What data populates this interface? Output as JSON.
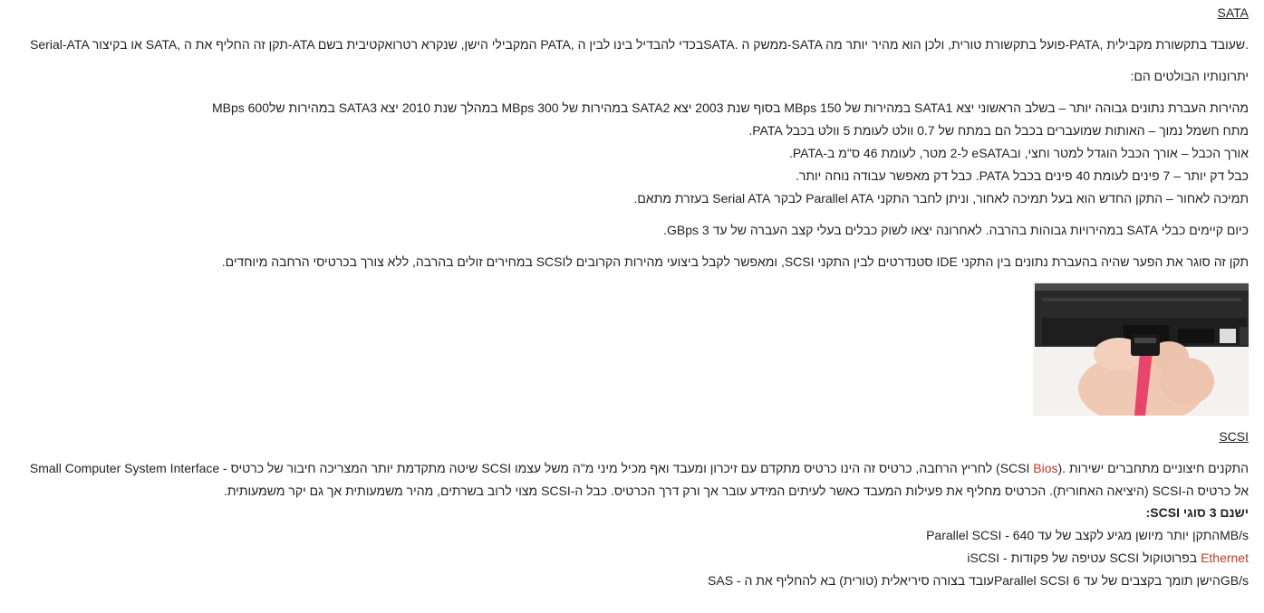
{
  "sata": {
    "heading": "SATA",
    "intro": "Serial-ATA או בקיצור SATA, תקן זה החליף את ה-ATA המקבילי הישן, שנקרא רטרואקטיבית בשם PATA, בכדי להבדיל בינו לבין הSATA. ממשק ה-SATA פועל בתקשורת טורית, ולכן הוא מהיר יותר מה-PATA, שעובד בתקשורת מקבילית.",
    "advantages_title": "יתרונותיו הבולטים הם:",
    "advantages": [
      "מהירות העברת נתונים גבוהה יותר – בשלב הראשוני יצא SATA1 במהירות של 150 MBps בסוף שנת 2003 יצא SATA2 במהירות של 300 MBps במהלך שנת 2010 יצא SATA3 במהירות של600 MBps",
      "מתח חשמל נמוך – האותות שמועברים בכבל הם במתח של 0.7 וולט לעומת 5 וולט בכבל PATA.",
      "אורך הכבל – אורך הכבל הוגדל למטר וחצי, ובeSATA ל-2 מטר, לעומת 46 ס\"מ ב-PATA.",
      "כבל דק יותר – 7 פינים לעומת 40 פינים בכבל PATA. כבל דק מאפשר עבודה נוחה יותר.",
      "תמיכה לאחור – התקן החדש הוא בעל תמיכה לאחור, וניתן לחבר התקני Parallel ATA לבקר Serial ATA בעזרת מתאם."
    ],
    "current": "כיום קיימים כבלי SATA במהירויות גבוהות בהרבה. לאחרונה יצאו לשוק כבלים בעלי קצב העברה של עד 3 GBps.",
    "gap": "תקן זה סוגר את הפער שהיה בהעברת נתונים בין התקני IDE סטנדרטים לבין התקני SCSI, ומאפשר לקבל ביצועי מהירות הקרובים לSCSI במחירים זולים בהרבה, ללא צורך בכרטיסי הרחבה מיוחדים."
  },
  "scsi": {
    "heading": "SCSI",
    "intro_line1_pre": "Small Computer System Interface - שיטה מתקדמת יותר המצריכה חיבור של כרטיס SCSI לחריץ הרחבה, כרטיס זה הינו כרטיס מתקדם עם זיכרון ומעבד ואף מכיל מיני מ\"ה משל עצמו (SCSI ",
    "bios_link": "Bios",
    "intro_line1_post": "). התקנים חיצוניים מתחברים ישירות",
    "intro_line2": "אל כרטיס ה-SCSI (היציאה האחורית). הכרטיס מחליף את פעילות המעבד כאשר לעיתים המידע עובר אך ורק דרך הכרטיס. כבל ה-SCSI מצוי לרוב בשרתים, מהיר משמעותית אך גם יקר משמעותית.",
    "types_title": "ישנם 3 סוגי SCSI:",
    "type_parallel": "Parallel SCSI - התקן יותר מיושן מגיע לקצב של עד 640MB/s",
    "type_iscsi_pre": "iSCSI - עטיפה של פקודות SCSI בפרוטוקול ",
    "ethernet_link": "Ethernet",
    "type_sas": "SAS - עובד בצורה סיריאלית (טורית) בא להחליף את הParallel SCSI הישן תומך בקצבים של עד 6GB/s"
  },
  "colors": {
    "text": "#222222",
    "link": "#c0392b",
    "cable": "#e8456a"
  },
  "image": {
    "icon": "sata-cable-photo"
  }
}
